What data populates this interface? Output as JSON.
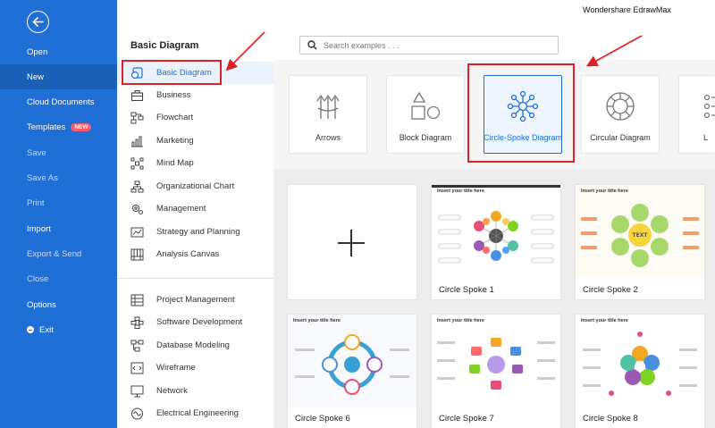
{
  "app": {
    "brand": "Wondershare EdrawMax"
  },
  "leftnav": {
    "items": [
      {
        "label": "Open"
      },
      {
        "label": "New"
      },
      {
        "label": "Cloud Documents"
      },
      {
        "label": "Templates",
        "badge": "NEW"
      },
      {
        "label": "Save"
      },
      {
        "label": "Save As"
      },
      {
        "label": "Print"
      },
      {
        "label": "Import"
      },
      {
        "label": "Export & Send"
      },
      {
        "label": "Close"
      },
      {
        "label": "Options"
      },
      {
        "label": "Exit"
      }
    ],
    "active": "New"
  },
  "categories": {
    "title": "Basic Diagram",
    "items": [
      {
        "label": "Basic Diagram",
        "icon": "basic-diagram-icon"
      },
      {
        "label": "Business",
        "icon": "briefcase-icon"
      },
      {
        "label": "Flowchart",
        "icon": "flowchart-icon"
      },
      {
        "label": "Marketing",
        "icon": "bar-chart-icon"
      },
      {
        "label": "Mind Map",
        "icon": "mind-map-icon"
      },
      {
        "label": "Organizational Chart",
        "icon": "org-chart-icon"
      },
      {
        "label": "Management",
        "icon": "gear-icon"
      },
      {
        "label": "Strategy and Planning",
        "icon": "strategy-icon"
      },
      {
        "label": "Analysis Canvas",
        "icon": "canvas-icon"
      }
    ],
    "items2": [
      {
        "label": "Project Management",
        "icon": "project-icon"
      },
      {
        "label": "Software Development",
        "icon": "software-icon"
      },
      {
        "label": "Database Modeling",
        "icon": "database-icon"
      },
      {
        "label": "Wireframe",
        "icon": "wireframe-icon"
      },
      {
        "label": "Network",
        "icon": "network-icon"
      },
      {
        "label": "Electrical Engineering",
        "icon": "electrical-icon"
      }
    ]
  },
  "search": {
    "placeholder": "Search examples . . ."
  },
  "types": [
    {
      "label": "Arrows",
      "icon": "arrows-icon"
    },
    {
      "label": "Block Diagram",
      "icon": "block-diagram-icon"
    },
    {
      "label": "Circle-Spoke Diagram",
      "icon": "circle-spoke-icon"
    },
    {
      "label": "Circular Diagram",
      "icon": "circular-diagram-icon"
    },
    {
      "label": "L",
      "icon": "list-icon"
    }
  ],
  "templates": [
    {
      "label": "",
      "blank": true
    },
    {
      "label": "Circle Spoke 1",
      "thumb_title": "Insert your title here"
    },
    {
      "label": "Circle Spoke 2",
      "thumb_title": "Insert your title here"
    },
    {
      "label": "Circle Spoke 6",
      "thumb_title": "Insert your title here"
    },
    {
      "label": "Circle Spoke 7",
      "thumb_title": "Insert your title here"
    },
    {
      "label": "Circle Spoke 8",
      "thumb_title": "Insert your title here"
    }
  ],
  "colors": {
    "nav_blue": "#1f6fd6",
    "highlight_red": "#e02020",
    "badge": "#ff5a6a"
  }
}
